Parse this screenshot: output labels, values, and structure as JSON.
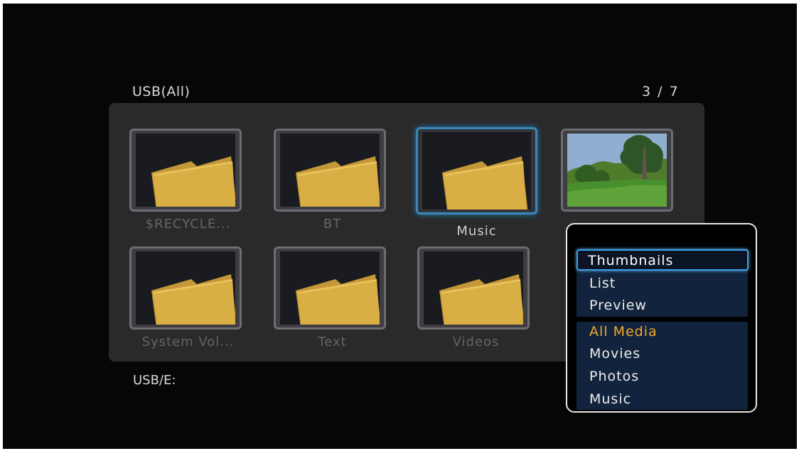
{
  "header": {
    "title": "USB(All)",
    "page_indicator": "3 / 7"
  },
  "grid": {
    "items": [
      {
        "label": "$RECYCLE...",
        "icon": "folder-icon"
      },
      {
        "label": "BT",
        "icon": "folder-icon"
      },
      {
        "label": "Music",
        "icon": "folder-icon",
        "selected": true
      },
      {
        "label": "",
        "icon": "photo-thumbnail"
      },
      {
        "label": "System Vol...",
        "icon": "folder-icon"
      },
      {
        "label": "Text",
        "icon": "folder-icon"
      },
      {
        "label": "Videos",
        "icon": "folder-icon"
      }
    ]
  },
  "footer": {
    "path": "USB/E:"
  },
  "view_menu": {
    "view_options": [
      "Thumbnails",
      "List",
      "Preview"
    ],
    "filter_options": [
      "All Media",
      "Movies",
      "Photos",
      "Music"
    ],
    "focused_item": "Thumbnails",
    "current_filter": "All Media"
  },
  "colors": {
    "background": "#000000",
    "panel": "#2a2a2a",
    "folder_yellow": "#d6ad3b",
    "selection_blue": "#3d87b5",
    "filter_orange": "#f0aa2d"
  }
}
